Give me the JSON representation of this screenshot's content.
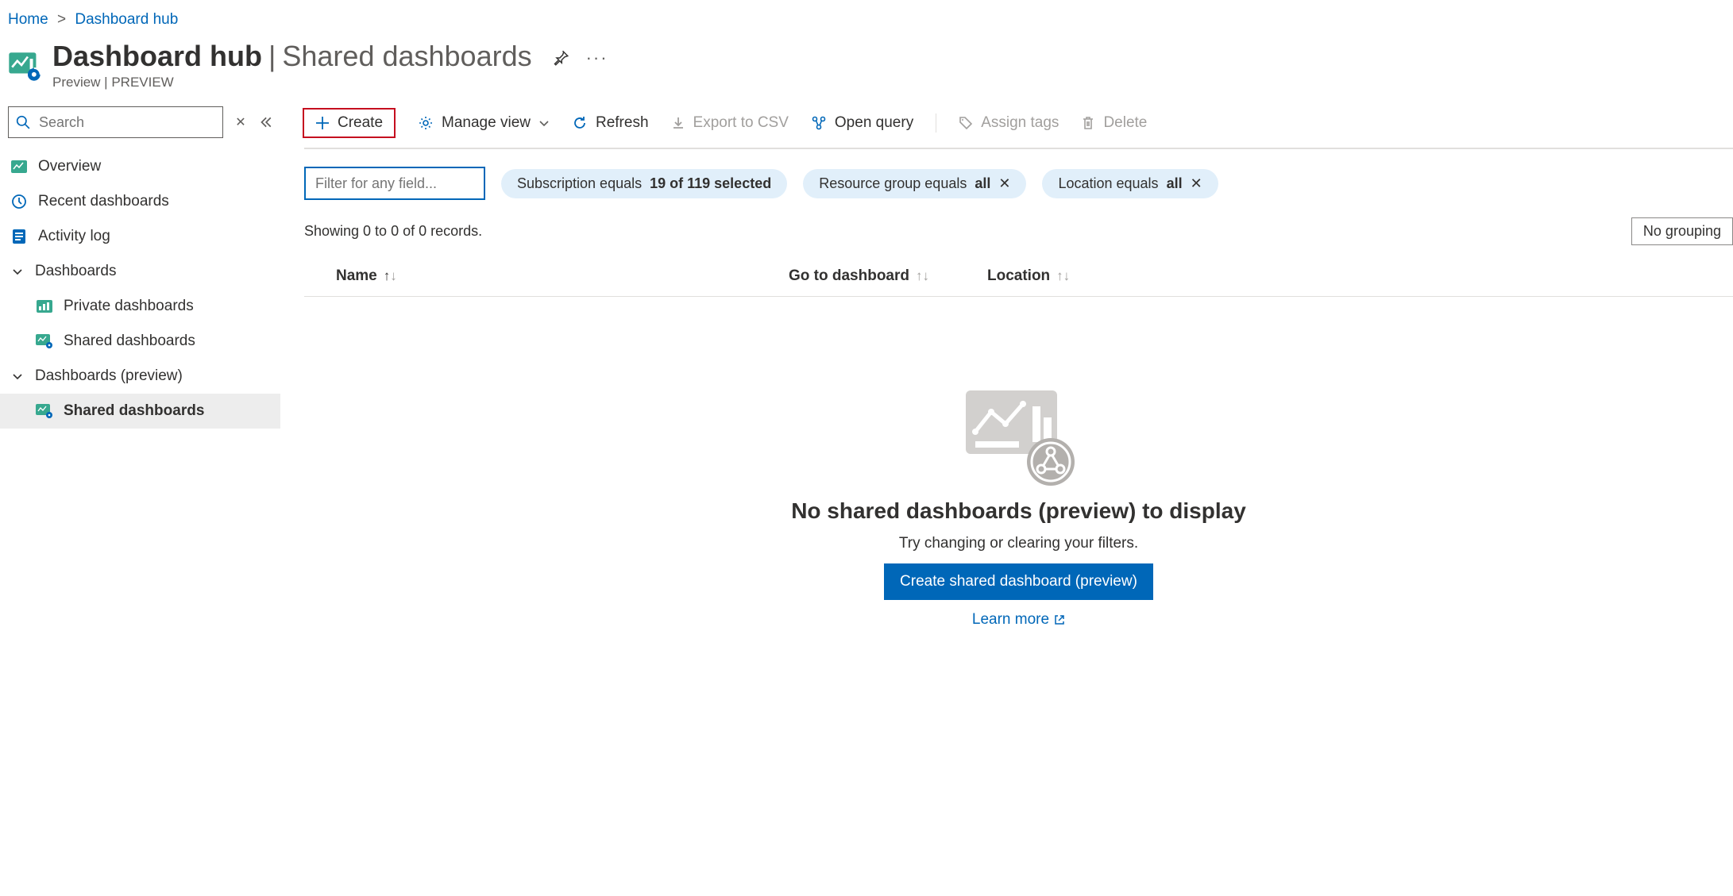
{
  "breadcrumb": {
    "home": "Home",
    "current": "Dashboard hub"
  },
  "header": {
    "title": "Dashboard hub",
    "subtitle": "Shared dashboards",
    "preview": "Preview | PREVIEW"
  },
  "sidebar": {
    "search_placeholder": "Search",
    "items": {
      "overview": "Overview",
      "recent": "Recent dashboards",
      "activity": "Activity log",
      "group_dashboards": "Dashboards",
      "private": "Private dashboards",
      "shared": "Shared dashboards",
      "group_preview": "Dashboards (preview)",
      "shared_preview": "Shared dashboards"
    }
  },
  "toolbar": {
    "create": "Create",
    "manage_view": "Manage view",
    "refresh": "Refresh",
    "export_csv": "Export to CSV",
    "open_query": "Open query",
    "assign_tags": "Assign tags",
    "delete": "Delete"
  },
  "filters": {
    "filter_placeholder": "Filter for any field...",
    "subscription_prefix": "Subscription equals ",
    "subscription_value": "19 of 119 selected",
    "rg_prefix": "Resource group equals ",
    "rg_value": "all",
    "loc_prefix": "Location equals ",
    "loc_value": "all"
  },
  "records": {
    "summary": "Showing 0 to 0 of 0 records.",
    "no_grouping": "No grouping"
  },
  "columns": {
    "name": "Name",
    "goto": "Go to dashboard",
    "location": "Location"
  },
  "empty": {
    "title": "No shared dashboards (preview) to display",
    "subtitle": "Try changing or clearing your filters.",
    "cta": "Create shared dashboard (preview)",
    "learn": "Learn more"
  }
}
